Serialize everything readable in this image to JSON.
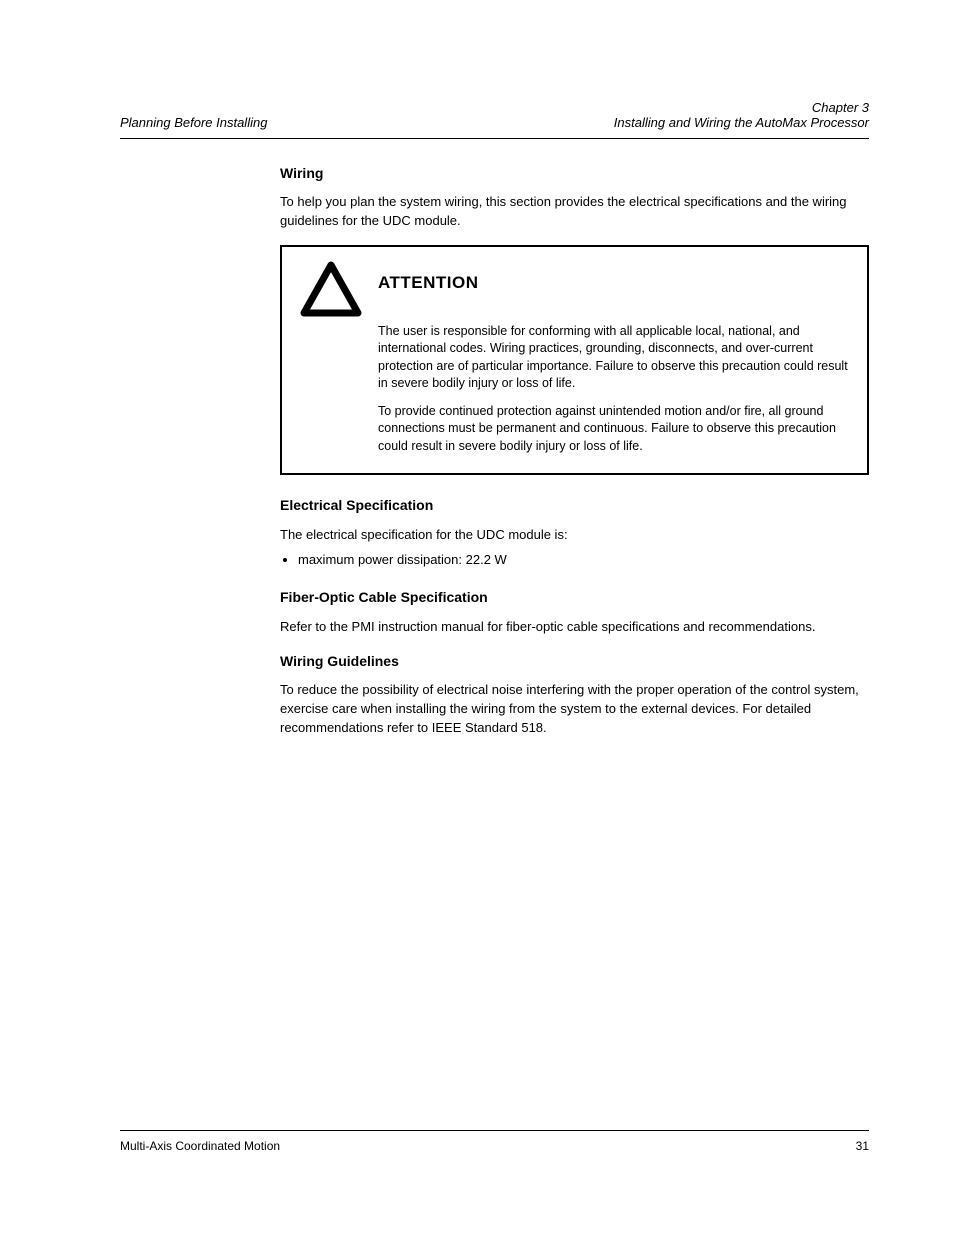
{
  "header": {
    "left": "Planning Before Installing",
    "right_line1": "Chapter 3",
    "right_line2": "Installing and Wiring the AutoMax Processor"
  },
  "section": {
    "title": "Wiring",
    "intro": "To help you plan the system wiring, this section provides the electrical specifications and the wiring guidelines for the UDC module."
  },
  "warning": {
    "title": "ATTENTION",
    "p1": "The user is responsible for conforming with all applicable local, national, and international codes. Wiring practices, grounding, disconnects, and over-current protection are of particular importance. Failure to observe this precaution could result in severe bodily injury or loss of life.",
    "p2": "To provide continued protection against unintended motion and/or fire, all ground connections must be permanent and continuous. Failure to observe this precaution could result in severe bodily injury or loss of life."
  },
  "spec": {
    "heading": "Electrical Specification",
    "text": "The electrical specification for the UDC module is:",
    "bullet": "maximum power dissipation: 22.2 W"
  },
  "fiber": {
    "heading": "Fiber-Optic Cable Specification",
    "text": "Refer to the PMI instruction manual for fiber-optic cable specifications and recommendations."
  },
  "guidelines": {
    "heading": "Wiring Guidelines",
    "text": "To reduce the possibility of electrical noise interfering with the proper operation of the control system, exercise care when installing the wiring from the system to the external devices. For detailed recommendations refer to IEEE Standard 518."
  },
  "footer": {
    "left": "Multi-Axis Coordinated Motion",
    "right": "31"
  }
}
